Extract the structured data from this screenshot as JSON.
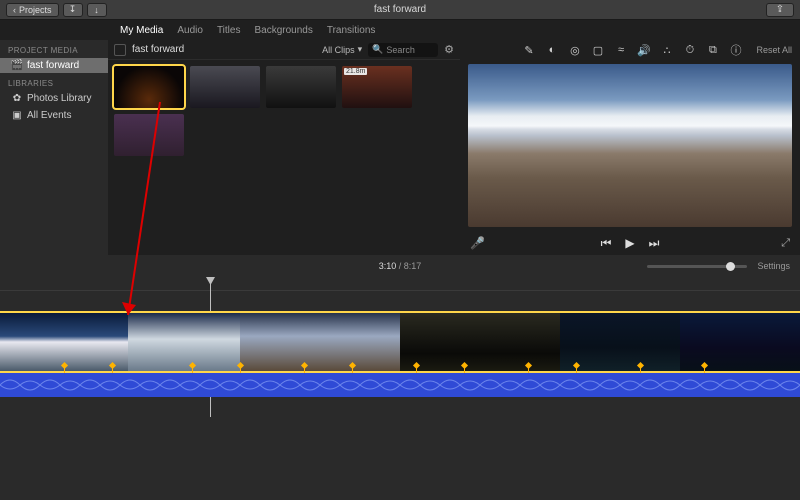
{
  "titlebar": {
    "projects_label": "Projects",
    "title": "fast forward"
  },
  "tabs": {
    "my_media": "My Media",
    "audio": "Audio",
    "titles": "Titles",
    "backgrounds": "Backgrounds",
    "transitions": "Transitions"
  },
  "sidebar": {
    "project_media_label": "PROJECT MEDIA",
    "project_name": "fast forward",
    "libraries_label": "LIBRARIES",
    "photos_library": "Photos Library",
    "all_events": "All Events"
  },
  "browser": {
    "crumb": "fast forward",
    "clips_filter": "All Clips",
    "search_placeholder": "Search",
    "clip_duration_badge": "21.8m"
  },
  "viewer": {
    "reset_label": "Reset All"
  },
  "timeline": {
    "current_time": "3:10",
    "total_time": "8:17",
    "settings_label": "Settings"
  }
}
